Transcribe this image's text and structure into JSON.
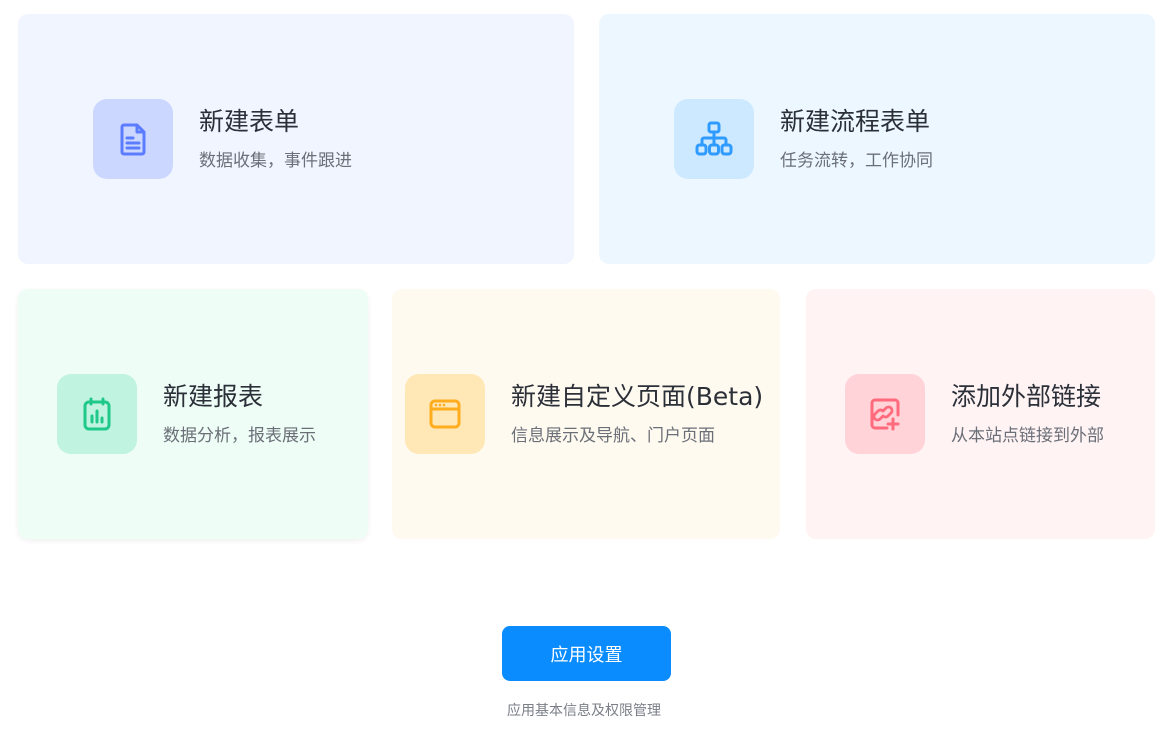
{
  "cards": [
    {
      "id": "form",
      "title": "新建表单",
      "desc": "数据收集，事件跟进",
      "icon": "form-document-icon",
      "accent": "#5b7cff"
    },
    {
      "id": "flow",
      "title": "新建流程表单",
      "desc": "任务流转，工作协同",
      "icon": "workflow-tree-icon",
      "accent": "#2f9bff"
    },
    {
      "id": "report",
      "title": "新建报表",
      "desc": "数据分析，报表展示",
      "icon": "report-chart-icon",
      "accent": "#20c98a"
    },
    {
      "id": "page",
      "title": "新建自定义页面(Beta)",
      "desc": "信息展示及导航、门户页面",
      "icon": "browser-window-icon",
      "accent": "#ffad1f"
    },
    {
      "id": "link",
      "title": "添加外部链接",
      "desc": "从本站点链接到外部",
      "icon": "external-link-icon",
      "accent": "#ff6a7d"
    }
  ],
  "settings": {
    "button_label": "应用设置",
    "caption": "应用基本信息及权限管理",
    "button_color": "#0a8cff"
  }
}
